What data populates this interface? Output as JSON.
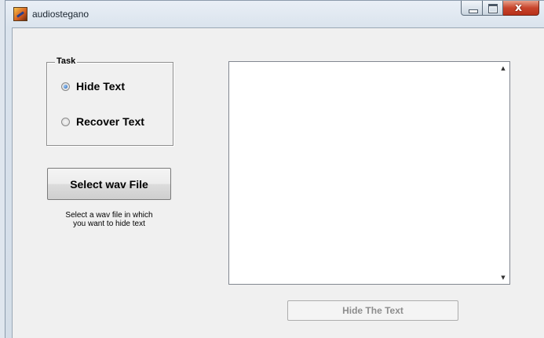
{
  "window": {
    "title": "audiostegano",
    "caption_close_glyph": "x"
  },
  "task_group": {
    "legend": "Task",
    "options": [
      {
        "label": "Hide Text",
        "selected": true
      },
      {
        "label": "Recover Text",
        "selected": false
      }
    ]
  },
  "actions": {
    "select_wav_label": "Select wav File",
    "hint_line1": "Select a wav file in which",
    "hint_line2": "you want to hide text",
    "hide_text_label": "Hide The Text",
    "hide_text_enabled": false
  },
  "text_area": {
    "value": "",
    "scroll_up_glyph": "▲",
    "scroll_down_glyph": "▼"
  },
  "icons": [
    "app-icon",
    "minimize-icon",
    "maximize-icon",
    "close-icon",
    "scroll-up-icon",
    "scroll-down-icon"
  ]
}
